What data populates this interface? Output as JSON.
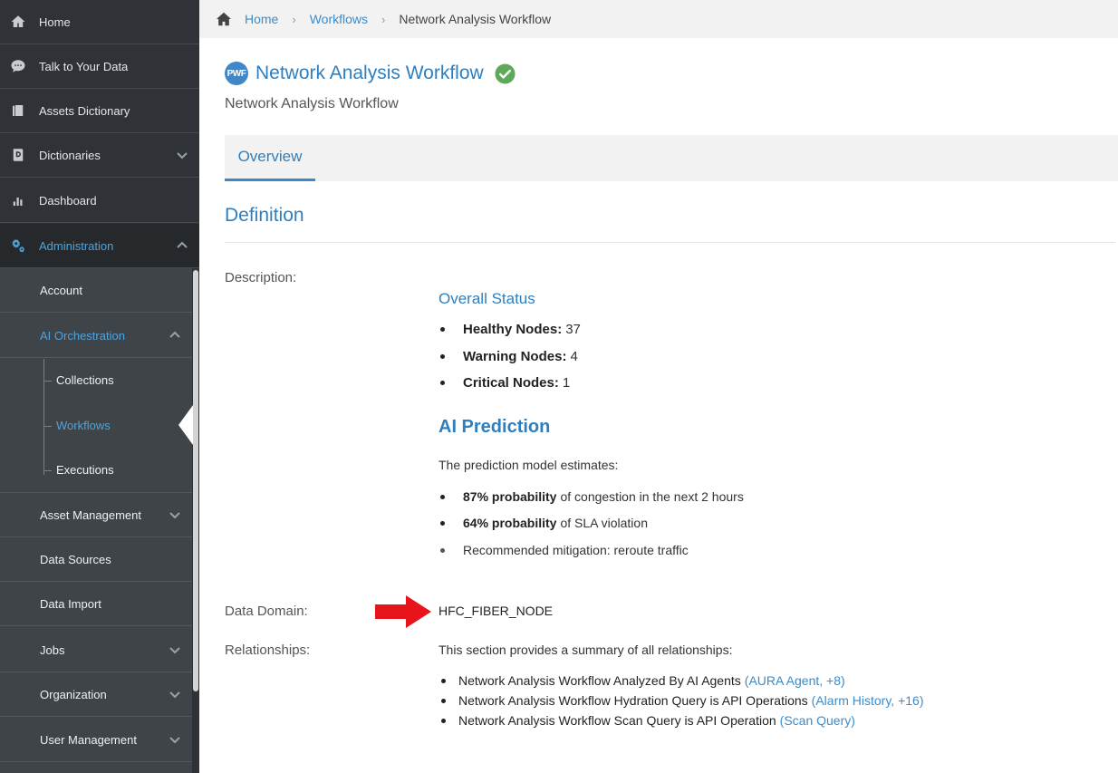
{
  "sidebar": {
    "top_items": [
      {
        "label": "Home",
        "icon": "home-icon"
      },
      {
        "label": "Talk to Your Data",
        "icon": "chat-icon"
      },
      {
        "label": "Assets Dictionary",
        "icon": "book-icon"
      },
      {
        "label": "Dictionaries",
        "icon": "dictionary-icon"
      },
      {
        "label": "Dashboard",
        "icon": "bar-chart-icon"
      },
      {
        "label": "Administration",
        "icon": "gears-icon"
      }
    ],
    "admin_items": [
      {
        "label": "Account"
      },
      {
        "label": "AI Orchestration"
      },
      {
        "label": "Asset Management"
      },
      {
        "label": "Data Sources"
      },
      {
        "label": "Data Import"
      },
      {
        "label": "Jobs"
      },
      {
        "label": "Organization"
      },
      {
        "label": "User Management"
      }
    ],
    "ai_orchestration_items": [
      {
        "label": "Collections"
      },
      {
        "label": "Workflows"
      },
      {
        "label": "Executions"
      }
    ]
  },
  "breadcrumb": {
    "home": "Home",
    "workflows": "Workflows",
    "current": "Network Analysis Workflow"
  },
  "header": {
    "badge": "PWF",
    "title": "Network Analysis Workflow",
    "subtitle": "Network Analysis Workflow"
  },
  "tabs": [
    {
      "label": "Overview"
    }
  ],
  "definition": {
    "section_title": "Definition",
    "description_label": "Description:",
    "overall_status_heading": "Overall Status",
    "status_items": [
      {
        "label": "Healthy Nodes:",
        "value": "37"
      },
      {
        "label": "Warning Nodes:",
        "value": "4"
      },
      {
        "label": "Critical Nodes:",
        "value": "1"
      }
    ],
    "prediction_heading": "AI Prediction",
    "prediction_intro": "The prediction model estimates:",
    "prediction_items": [
      {
        "bold": "87% probability",
        "text": "of congestion in the next 2 hours"
      },
      {
        "bold": "64% probability",
        "text": "of SLA violation"
      },
      {
        "bold": "",
        "text": "Recommended mitigation: reroute traffic"
      }
    ],
    "data_domain_label": "Data Domain:",
    "data_domain_value": "HFC_FIBER_NODE",
    "relationships_label": "Relationships:",
    "relationships_intro": "This section provides a summary of all relationships:",
    "relationships": [
      {
        "text": "Network Analysis Workflow Analyzed By AI Agents",
        "link": "(AURA Agent, +8)"
      },
      {
        "text": "Network Analysis Workflow Hydration Query is API Operations",
        "link": "(Alarm History, +16)"
      },
      {
        "text": "Network Analysis Workflow Scan Query is API Operation",
        "link": "(Scan Query)"
      }
    ]
  },
  "colors": {
    "sidebar_bg": "#2f3337",
    "submenu_bg": "#3f4449",
    "accent_blue": "#2f7fbf",
    "link_blue": "#3a8ccc",
    "success_green": "#5fa85a",
    "annotation_red": "#e8141c"
  }
}
